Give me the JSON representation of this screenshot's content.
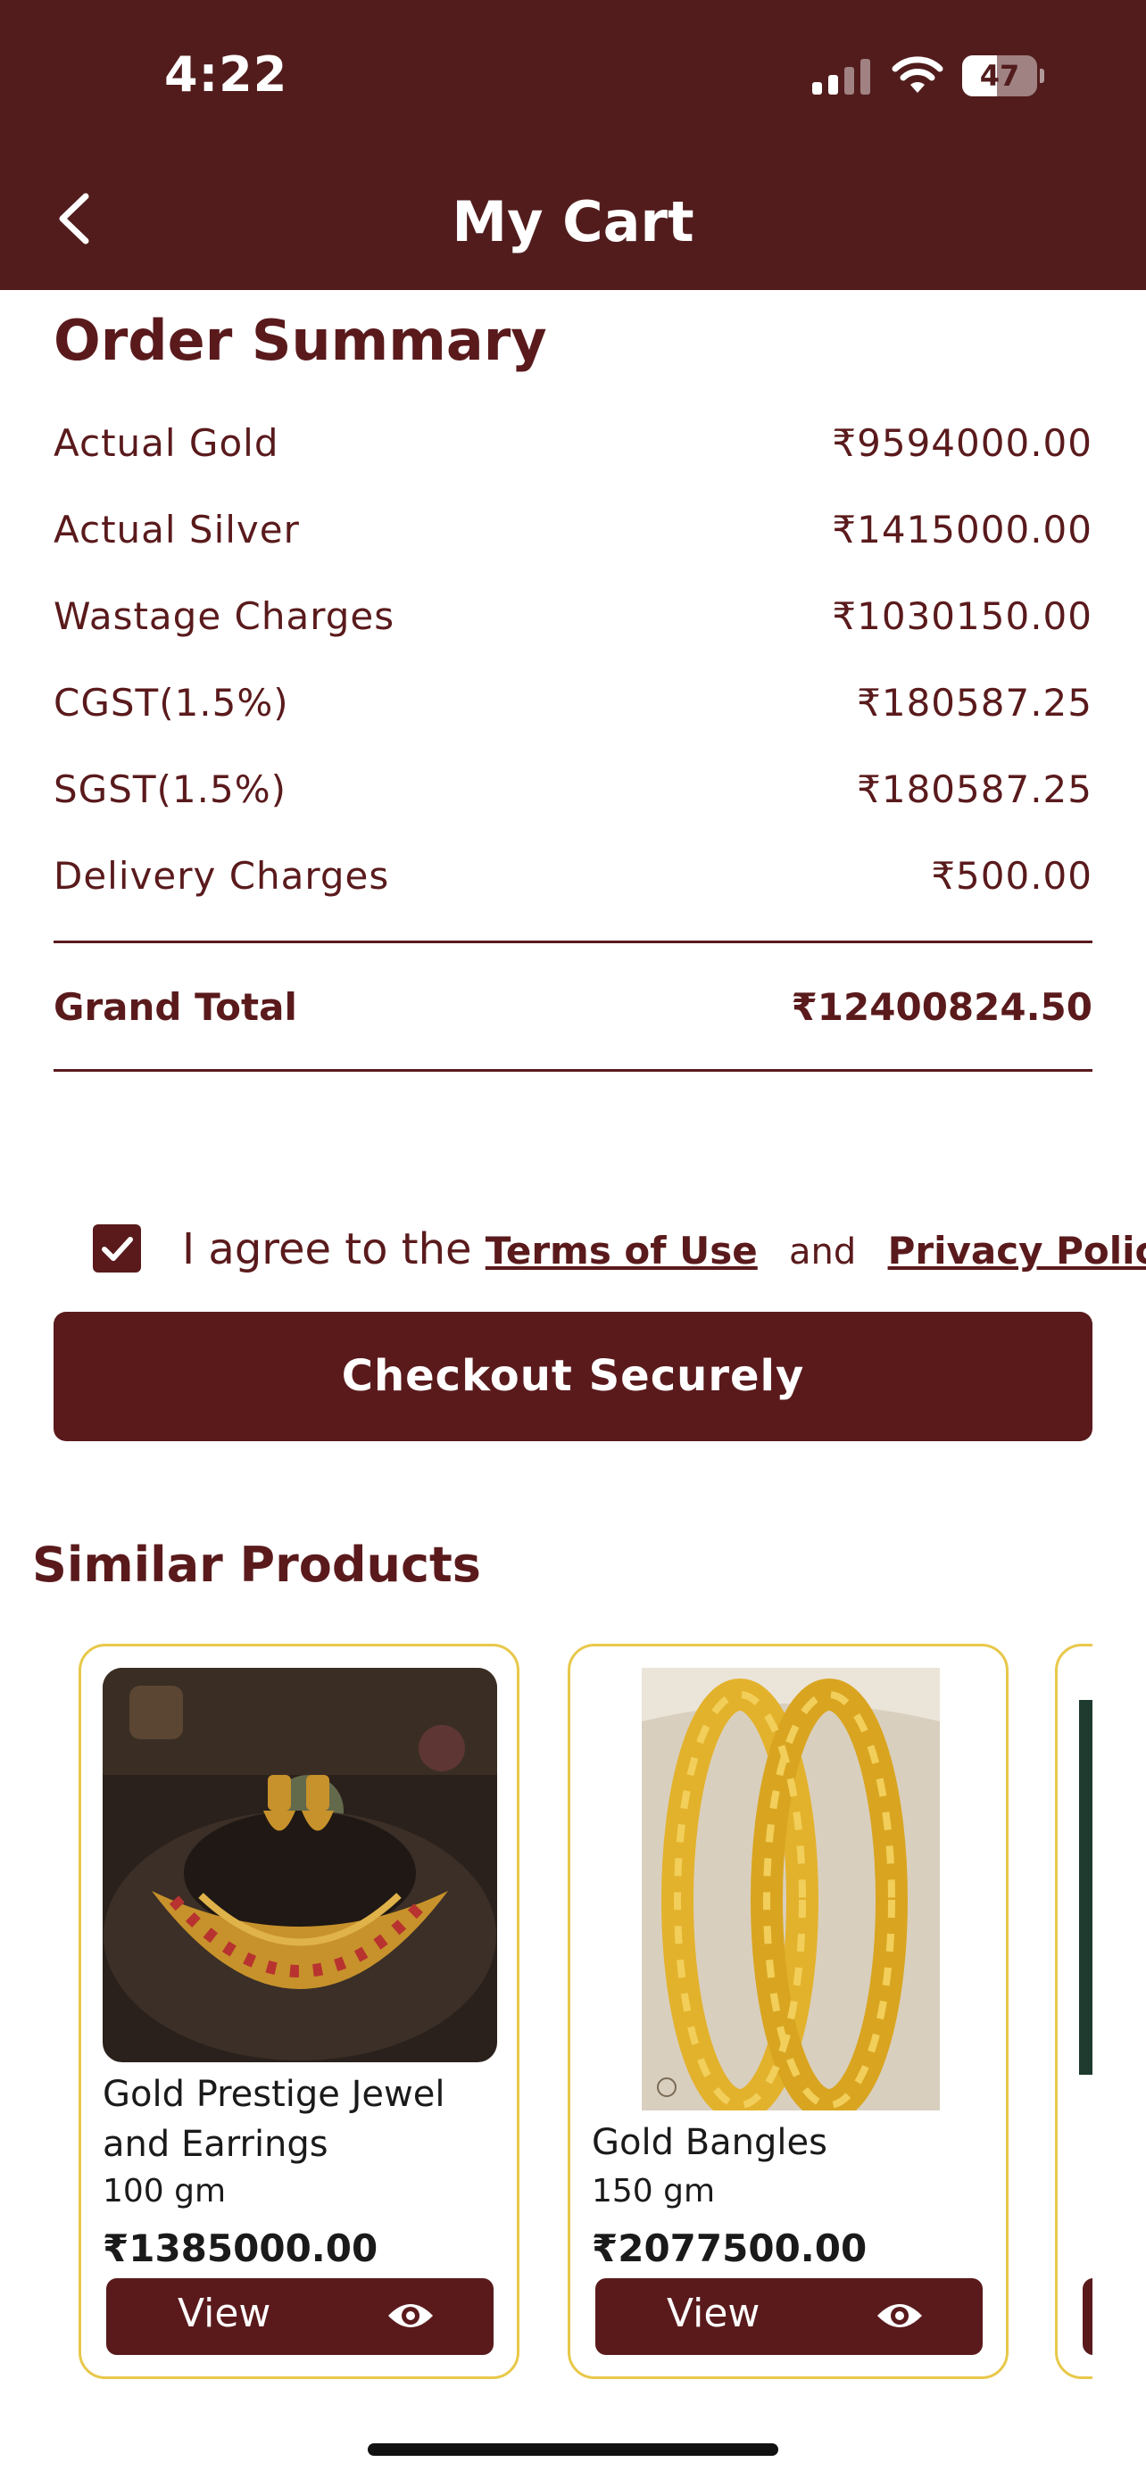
{
  "status_bar": {
    "time": "4:22",
    "battery_level": "47",
    "battery_fraction": 0.47
  },
  "header": {
    "title": "My Cart"
  },
  "order_summary": {
    "title": "Order Summary",
    "rows": [
      {
        "label": "Actual Gold",
        "value": "₹9594000.00"
      },
      {
        "label": "Actual Silver",
        "value": "₹1415000.00"
      },
      {
        "label": "Wastage Charges",
        "value": "₹1030150.00"
      },
      {
        "label": "CGST(1.5%)",
        "value": "₹180587.25"
      },
      {
        "label": "SGST(1.5%)",
        "value": "₹180587.25"
      },
      {
        "label": "Delivery Charges",
        "value": "₹500.00"
      }
    ],
    "grand_total_label": "Grand Total",
    "grand_total_value": "₹12400824.50"
  },
  "agreement": {
    "checked": true,
    "prefix": "I agree to the",
    "terms_link": "Terms of Use",
    "and": "and",
    "privacy_link": "Privacy Policy"
  },
  "checkout_button": "Checkout Securely",
  "similar_products": {
    "title": "Similar Products",
    "items": [
      {
        "name": "Gold Prestige Jewel and Earrings",
        "weight": "100 gm",
        "price": "₹1385000.00",
        "view_label": "View"
      },
      {
        "name": "Gold Bangles",
        "weight": "150 gm",
        "price": "₹2077500.00",
        "view_label": "View"
      }
    ]
  },
  "colors": {
    "primary": "#521c1d",
    "card_border": "#e8c84a",
    "text": "#5a1a1c"
  }
}
